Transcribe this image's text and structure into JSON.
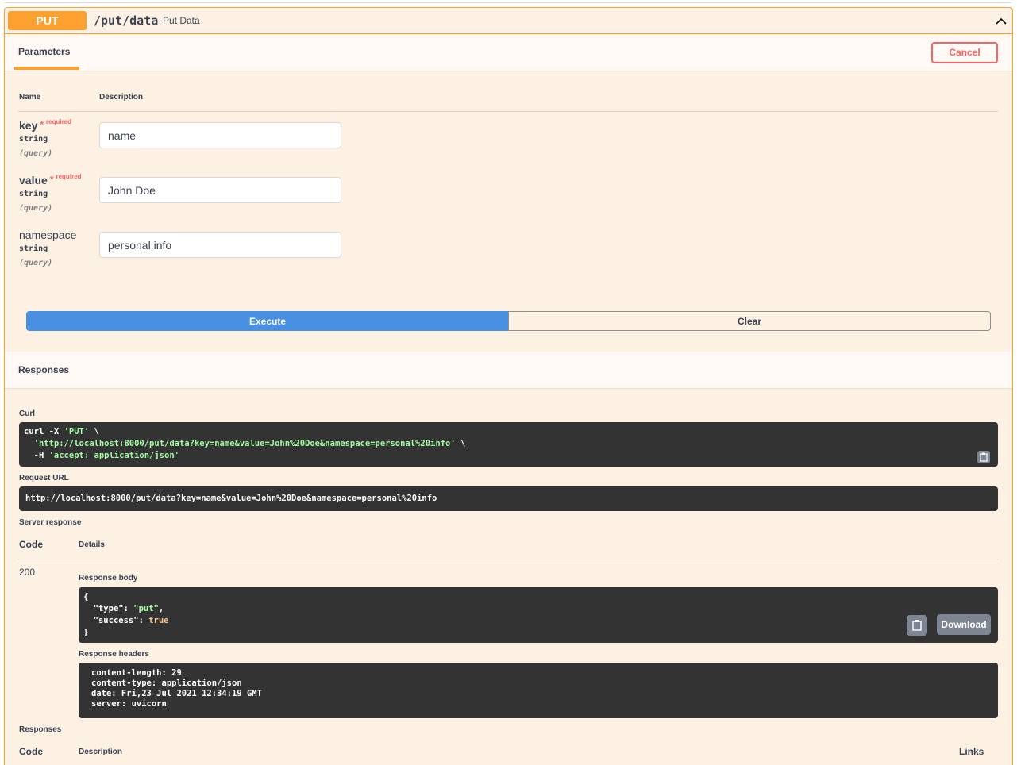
{
  "operation": {
    "method": "PUT",
    "path": "/put/data",
    "summary": "Put Data"
  },
  "parameters_section": {
    "tab_label": "Parameters",
    "cancel_label": "Cancel",
    "col_name": "Name",
    "col_description": "Description",
    "required_marker": "*",
    "required_text": "required",
    "params": [
      {
        "name": "key",
        "type": "string",
        "in": "(query)",
        "required": true,
        "value": "name"
      },
      {
        "name": "value",
        "type": "string",
        "in": "(query)",
        "required": true,
        "value": "John Doe"
      },
      {
        "name": "namespace",
        "type": "string",
        "in": "(query)",
        "required": false,
        "value": "personal info"
      }
    ],
    "execute_label": "Execute",
    "clear_label": "Clear"
  },
  "responses_section": {
    "title": "Responses",
    "curl_label": "Curl",
    "curl_line1_cmd": "curl -X ",
    "curl_line1_method": "'PUT'",
    "curl_line1_cont": " \\",
    "curl_line2_url": "'http://localhost:8000/put/data?key=name&value=John%20Doe&namespace=personal%20info'",
    "curl_line2_cont": " \\",
    "curl_line3_flag": "  -H ",
    "curl_line3_header": "'accept: application/json'",
    "request_url_label": "Request URL",
    "request_url": "http://localhost:8000/put/data?key=name&value=John%20Doe&namespace=personal%20info",
    "server_response_label": "Server response",
    "code_col": "Code",
    "details_col": "Details",
    "status_code": "200",
    "response_body_label": "Response body",
    "body": {
      "open": "{",
      "type_key": "\"type\"",
      "type_val": "\"put\"",
      "success_key": "\"success\"",
      "success_val": "true",
      "close": "}"
    },
    "download_label": "Download",
    "response_headers_label": "Response headers",
    "headers": [
      "content-length: 29",
      "content-type: application/json",
      "date: Fri,23 Jul 2021 12:34:19 GMT",
      "server: uvicorn"
    ],
    "responses_label": "Responses",
    "bottom_code_col": "Code",
    "bottom_description_col": "Description",
    "bottom_links_col": "Links"
  }
}
